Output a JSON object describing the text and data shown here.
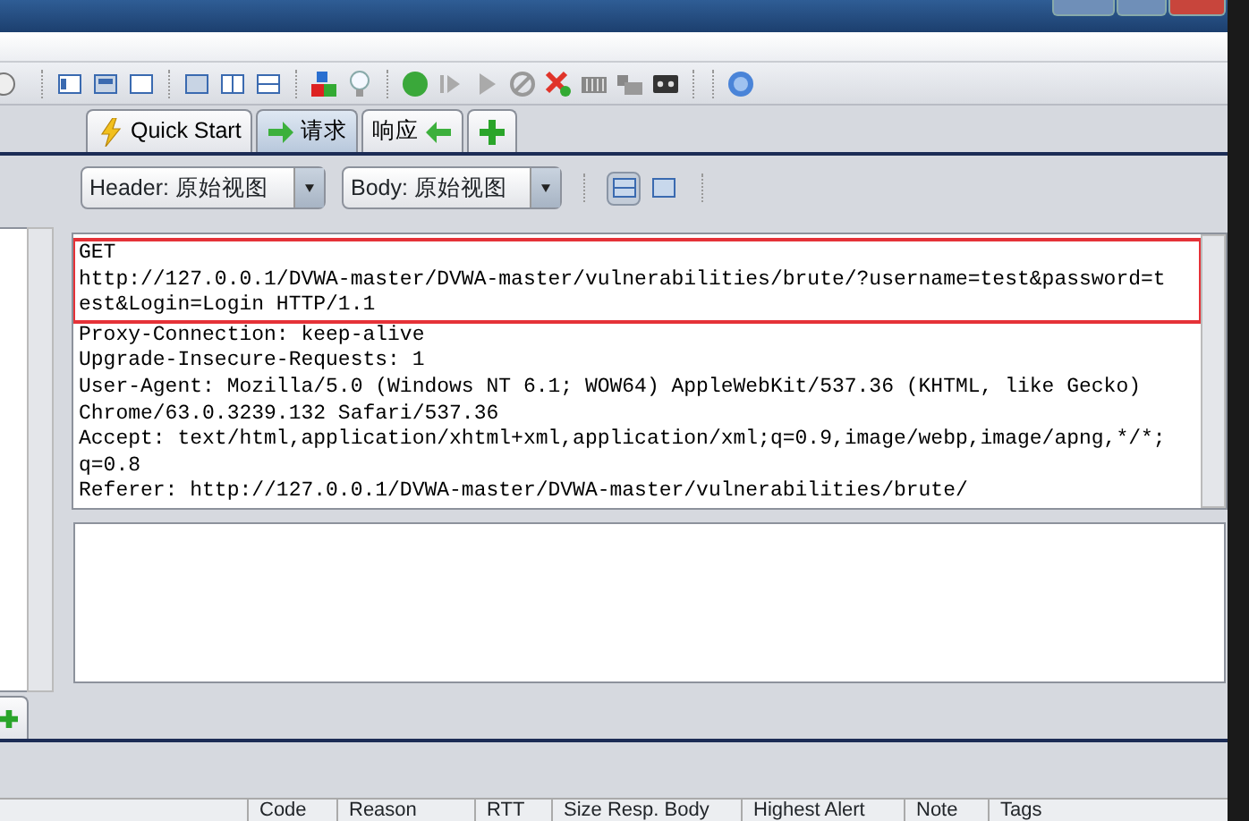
{
  "tabs": [
    {
      "label": "Quick Start",
      "kind": "start",
      "selected": false
    },
    {
      "label": "请求",
      "kind": "request",
      "selected": true
    },
    {
      "label": "响应",
      "kind": "response",
      "selected": false
    },
    {
      "kind": "add",
      "selected": false
    }
  ],
  "view_selectors": [
    {
      "value": "Header: 原始视图"
    },
    {
      "value": "Body: 原始视图"
    }
  ],
  "layout_toggles": [
    {
      "selected": true
    },
    {
      "selected": false
    }
  ],
  "request_lines": [
    {
      "text": "GET",
      "highlighted": true
    },
    {
      "text": "http://127.0.0.1/DVWA-master/DVWA-master/vulnerabilities/brute/?username=test&password=t",
      "highlighted": true
    },
    {
      "text": "est&Login=Login HTTP/1.1",
      "highlighted": true
    },
    {
      "text": "Proxy-Connection: keep-alive",
      "highlighted": false
    },
    {
      "text": "Upgrade-Insecure-Requests: 1",
      "highlighted": false
    },
    {
      "text": "User-Agent: Mozilla/5.0 (Windows NT 6.1; WOW64) AppleWebKit/537.36 (KHTML, like Gecko)",
      "highlighted": false
    },
    {
      "text": "Chrome/63.0.3239.132 Safari/537.36",
      "highlighted": false
    },
    {
      "text": "Accept: text/html,application/xhtml+xml,application/xml;q=0.9,image/webp,image/apng,*/*;",
      "highlighted": false
    },
    {
      "text": "q=0.8",
      "highlighted": false
    },
    {
      "text": "Referer: http://127.0.0.1/DVWA-master/DVWA-master/vulnerabilities/brute/",
      "highlighted": false
    }
  ],
  "history_table": {
    "columns": [
      "Code",
      "Reason",
      "RTT",
      "Size Resp. Body",
      "Highest Alert",
      "Note",
      "Tags"
    ]
  }
}
